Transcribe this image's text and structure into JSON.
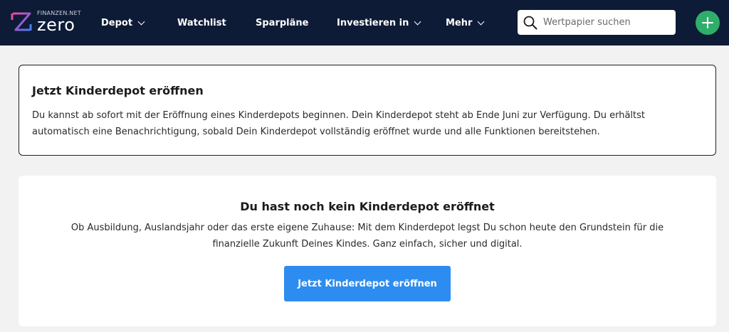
{
  "header": {
    "logo": {
      "brand_small": "FINANZEN.NET",
      "brand_main": "zero"
    },
    "nav": [
      {
        "label": "Depot",
        "dropdown": true
      },
      {
        "label": "Watchlist",
        "dropdown": false
      },
      {
        "label": "Sparpläne",
        "dropdown": false
      },
      {
        "label": "Investieren in",
        "dropdown": true
      },
      {
        "label": "Mehr",
        "dropdown": true
      }
    ],
    "search": {
      "placeholder": "Wertpapier suchen",
      "value": "",
      "icon": "search-icon"
    },
    "add_button": {
      "icon": "plus-icon",
      "color": "#2fae6b"
    }
  },
  "info_card": {
    "title": "Jetzt Kinderdepot eröffnen",
    "text": "Du kannst ab sofort mit der Eröffnung eines Kinderdepots beginnen. Dein Kinderdepot steht ab Ende Juni zur Verfügung. Du erhältst automatisch eine Benachrichtigung, sobald Dein Kinderdepot vollständig eröffnet wurde und alle Funktionen bereitstehen."
  },
  "empty_state": {
    "title": "Du hast noch kein Kinderdepot eröffnet",
    "text": "Ob Ausbildung, Auslandsjahr oder das erste eigene Zuhause: Mit dem Kinderdepot legst Du schon heute den Grundstein für die finanzielle Zukunft Deines Kindes. Ganz einfach, sicher und digital.",
    "cta_label": "Jetzt Kinderdepot eröffnen"
  },
  "colors": {
    "navbar_bg": "#0e1b36",
    "page_bg": "#f2f2f3",
    "primary_button": "#2d8cf0",
    "accent_green": "#2fae6b"
  }
}
